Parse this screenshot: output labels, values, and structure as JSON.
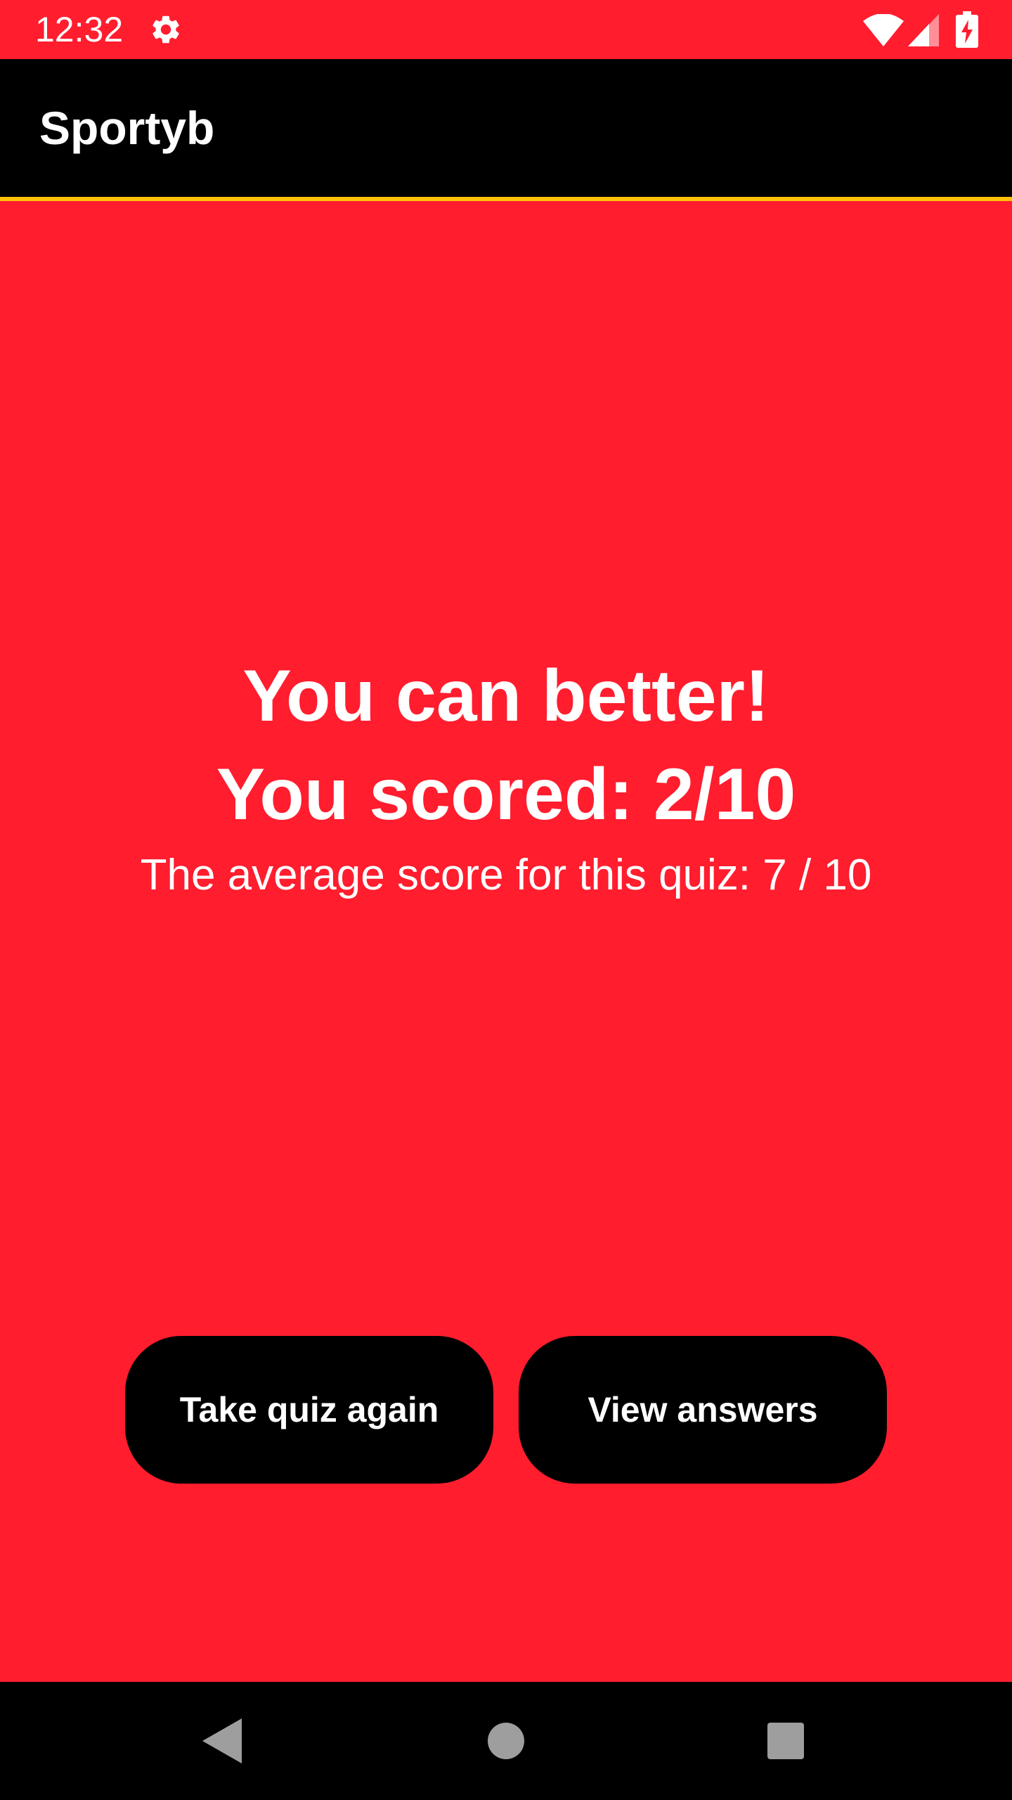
{
  "status_bar": {
    "time": "12:32",
    "icons": [
      "gear-icon",
      "wifi-icon",
      "signal-icon",
      "battery-charging-icon"
    ]
  },
  "app_bar": {
    "title": "Sportyb"
  },
  "result": {
    "headline": "You can better!",
    "score": "You scored: 2/10",
    "average": "The average score for this quiz: 7 / 10"
  },
  "buttons": {
    "retake": "Take quiz again",
    "view_answers": "View answers"
  },
  "nav_bar": {
    "icons": [
      "back-icon",
      "home-icon",
      "recents-icon"
    ]
  },
  "colors": {
    "background": "#ff1d2e",
    "bar": "#000000",
    "accent_line": "#ffc107",
    "text": "#ffffff"
  }
}
